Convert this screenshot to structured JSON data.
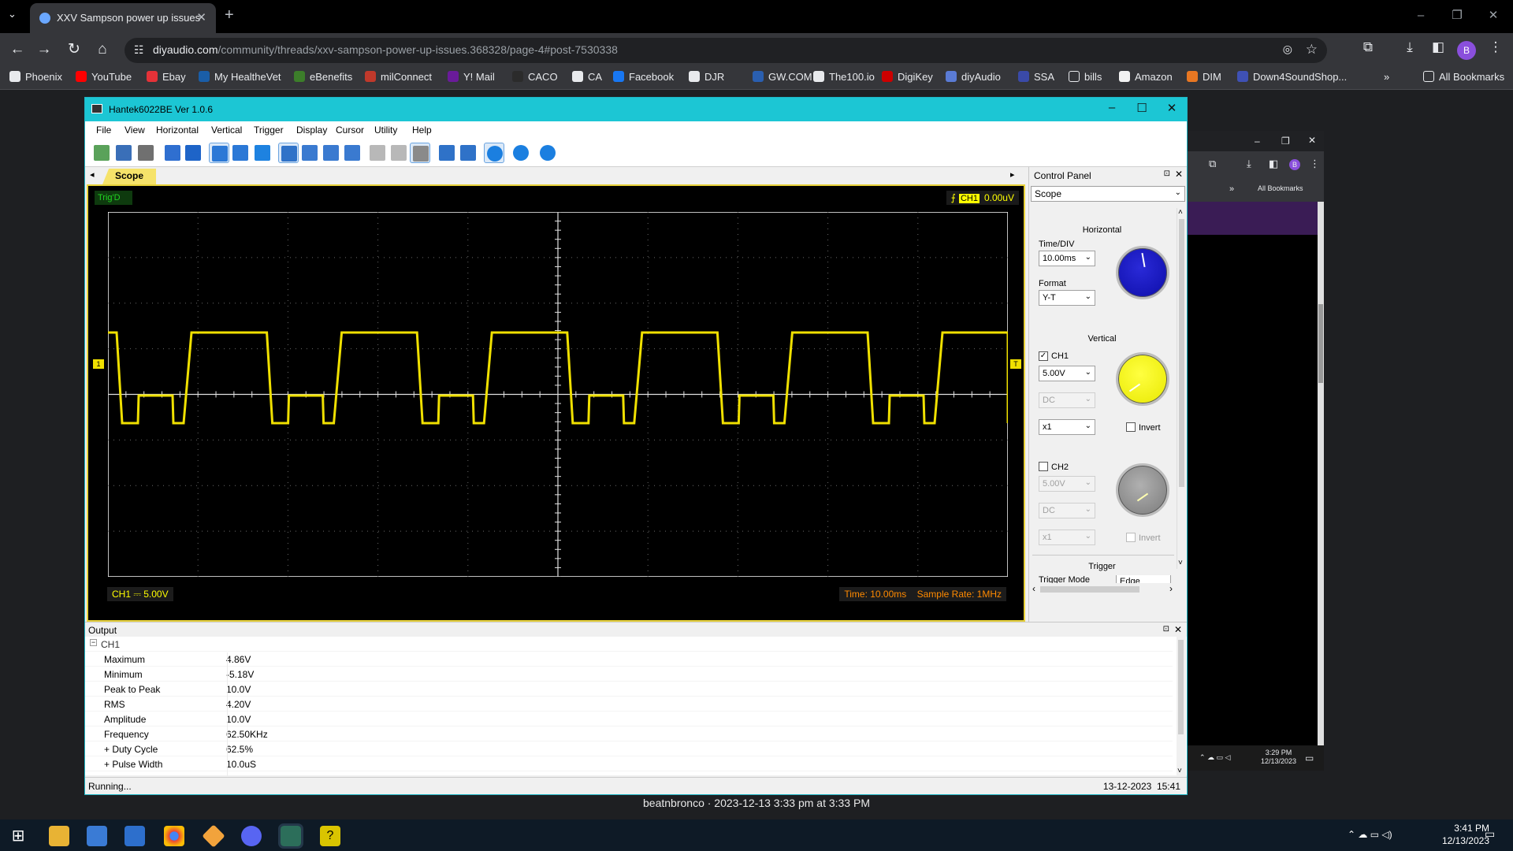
{
  "browser": {
    "tab_title": "XXV Sampson power up issues",
    "url_host": "diyaudio.com",
    "url_path": "/community/threads/xxv-sampson-power-up-issues.368328/page-4#post-7530338",
    "profile_initial": "B",
    "bookmarks": [
      "Phoenix",
      "YouTube",
      "Ebay",
      "My HealtheVet",
      "eBenefits",
      "milConnect",
      "Y! Mail",
      "CACO",
      "CA",
      "Facebook",
      "DJR",
      "GW.COM",
      "The100.io",
      "DigiKey",
      "diyAudio",
      "SSA",
      "bills",
      "Amazon",
      "DIM",
      "Down4SoundShop..."
    ],
    "all_bookmarks": "All Bookmarks",
    "more": "»"
  },
  "caption": "beatnbronco · 2023-12-13 3:33 pm at 3:33 PM",
  "bg_window": {
    "all_bookmarks": "All Bookmarks",
    "profile_initial": "B",
    "tray_time": "3:29 PM",
    "tray_date": "12/13/2023"
  },
  "hantek": {
    "title": "Hantek6022BE Ver 1.0.6",
    "menu": [
      "File",
      "View",
      "Horizontal",
      "Vertical",
      "Trigger",
      "Display",
      "Cursor",
      "Utility",
      "Help"
    ],
    "tab": "Scope",
    "trig_status": "Trig'D",
    "trig_channel": "CH1",
    "trig_level": "0.00uV",
    "ch1_info": "CH1 ⎓  5.00V",
    "time_info": "Time: 10.00ms",
    "sample_rate": "Sample Rate: 1MHz",
    "control_panel": {
      "title": "Control Panel",
      "mode": "Scope",
      "horizontal": "Horizontal",
      "time_div_label": "Time/DIV",
      "time_div": "10.00ms",
      "format_label": "Format",
      "format": "Y-T",
      "vertical": "Vertical",
      "ch1_label": "CH1",
      "ch1_volts": "5.00V",
      "ch1_coupling": "DC",
      "ch1_probe": "x1",
      "ch1_invert": "Invert",
      "ch2_label": "CH2",
      "ch2_volts": "5.00V",
      "ch2_coupling": "DC",
      "ch2_probe": "x1",
      "ch2_invert": "Invert",
      "trigger": "Trigger",
      "trigger_mode": "Trigger Mode",
      "trigger_mode_value": "Edge"
    },
    "output": {
      "title": "Output",
      "channel": "CH1",
      "rows": [
        {
          "name": "Maximum",
          "value": "4.86V"
        },
        {
          "name": "Minimum",
          "value": "-5.18V"
        },
        {
          "name": "Peak to Peak",
          "value": "10.0V"
        },
        {
          "name": "RMS",
          "value": "4.20V"
        },
        {
          "name": "Amplitude",
          "value": "10.0V"
        },
        {
          "name": "Frequency",
          "value": "62.50KHz"
        },
        {
          "name": "+ Duty Cycle",
          "value": "62.5%"
        },
        {
          "name": "+ Pulse Width",
          "value": "10.0uS"
        }
      ]
    },
    "status_left": "Running...",
    "status_right": "13-12-2023  15:41"
  },
  "taskbar": {
    "time": "3:41 PM",
    "date": "12/13/2023"
  }
}
